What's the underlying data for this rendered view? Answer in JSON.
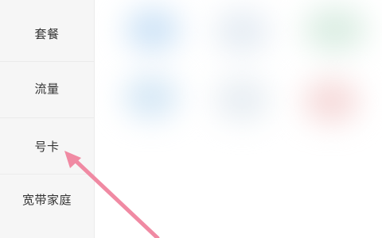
{
  "sidebar": {
    "items": [
      {
        "label": "套餐"
      },
      {
        "label": "流量"
      },
      {
        "label": "号卡"
      },
      {
        "label": "宽带家庭"
      }
    ]
  },
  "content": {
    "tiles": [
      {
        "color": "#cfe4f7"
      },
      {
        "color": "#e6edf4"
      },
      {
        "color": "#dceee4"
      },
      {
        "color": "#d6e8f6"
      },
      {
        "color": "#e8eef3"
      },
      {
        "color": "#f6dada"
      }
    ]
  },
  "annotation": {
    "arrow_color": "#f08aa3",
    "target": "号卡"
  },
  "colors": {
    "sidebar_bg": "#f6f6f6",
    "text": "#333333",
    "arrow": "#f08aa3"
  }
}
